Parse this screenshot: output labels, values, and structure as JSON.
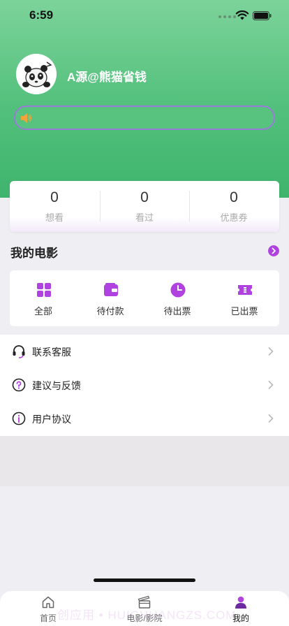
{
  "status_bar": {
    "time": "6:59"
  },
  "profile": {
    "username": "A源@熊猫省钱"
  },
  "stats": [
    {
      "value": "0",
      "label": "想看"
    },
    {
      "value": "0",
      "label": "看过"
    },
    {
      "value": "0",
      "label": "优惠券"
    }
  ],
  "my_movies": {
    "title": "我的电影",
    "items": [
      {
        "label": "全部",
        "icon": "grid-icon"
      },
      {
        "label": "待付款",
        "icon": "wallet-icon"
      },
      {
        "label": "待出票",
        "icon": "clock-icon"
      },
      {
        "label": "已出票",
        "icon": "ticket-icon"
      }
    ]
  },
  "menu": [
    {
      "label": "联系客服",
      "icon": "headset-icon"
    },
    {
      "label": "建议与反馈",
      "icon": "question-icon"
    },
    {
      "label": "用户协议",
      "icon": "info-icon"
    }
  ],
  "tabbar": [
    {
      "label": "首页",
      "icon": "home-icon"
    },
    {
      "label": "电影/影院",
      "icon": "clapperboard-icon"
    },
    {
      "label": "我的",
      "icon": "user-icon",
      "active": true
    }
  ],
  "watermark": "创应用 • HUICHUANGZS.COM",
  "colors": {
    "accent": "#b043e0",
    "header_top": "#7cd39a",
    "header_bottom": "#3fb46d"
  }
}
